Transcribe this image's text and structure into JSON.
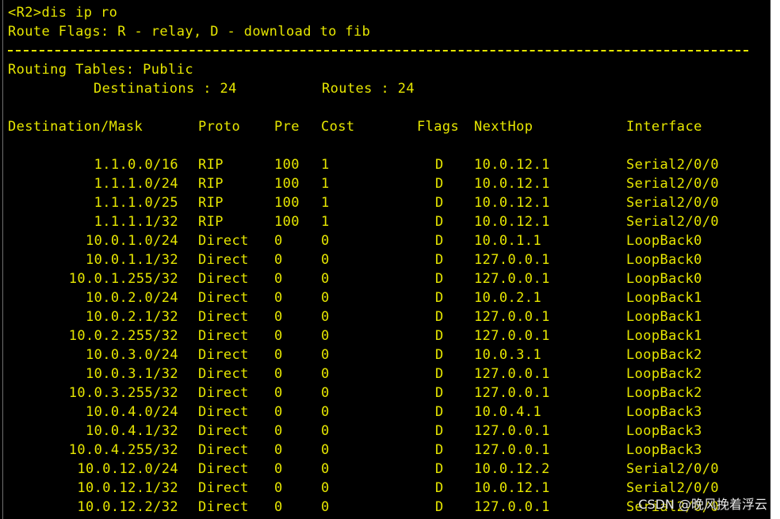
{
  "terminal": {
    "prompt_line": "<R2>dis ip ro",
    "flags_line": "Route Flags: R - relay, D - download to fib",
    "tables_label": "Routing Tables: Public",
    "destinations_label": "Destinations : 24",
    "routes_label": "Routes : 24",
    "headers": {
      "destination": "Destination/Mask",
      "proto": "Proto",
      "pre": "Pre",
      "cost": "Cost",
      "flags": "Flags",
      "nexthop": "NextHop",
      "interface": "Interface"
    },
    "routes": [
      {
        "dest": "1.1.0.0/16",
        "proto": "RIP",
        "pre": "100",
        "cost": "1",
        "flags": "D",
        "nexthop": "10.0.12.1",
        "iface": "Serial2/0/0"
      },
      {
        "dest": "1.1.1.0/24",
        "proto": "RIP",
        "pre": "100",
        "cost": "1",
        "flags": "D",
        "nexthop": "10.0.12.1",
        "iface": "Serial2/0/0"
      },
      {
        "dest": "1.1.1.0/25",
        "proto": "RIP",
        "pre": "100",
        "cost": "1",
        "flags": "D",
        "nexthop": "10.0.12.1",
        "iface": "Serial2/0/0"
      },
      {
        "dest": "1.1.1.1/32",
        "proto": "RIP",
        "pre": "100",
        "cost": "1",
        "flags": "D",
        "nexthop": "10.0.12.1",
        "iface": "Serial2/0/0"
      },
      {
        "dest": "10.0.1.0/24",
        "proto": "Direct",
        "pre": "0",
        "cost": "0",
        "flags": "D",
        "nexthop": "10.0.1.1",
        "iface": "LoopBack0"
      },
      {
        "dest": "10.0.1.1/32",
        "proto": "Direct",
        "pre": "0",
        "cost": "0",
        "flags": "D",
        "nexthop": "127.0.0.1",
        "iface": "LoopBack0"
      },
      {
        "dest": "10.0.1.255/32",
        "proto": "Direct",
        "pre": "0",
        "cost": "0",
        "flags": "D",
        "nexthop": "127.0.0.1",
        "iface": "LoopBack0"
      },
      {
        "dest": "10.0.2.0/24",
        "proto": "Direct",
        "pre": "0",
        "cost": "0",
        "flags": "D",
        "nexthop": "10.0.2.1",
        "iface": "LoopBack1"
      },
      {
        "dest": "10.0.2.1/32",
        "proto": "Direct",
        "pre": "0",
        "cost": "0",
        "flags": "D",
        "nexthop": "127.0.0.1",
        "iface": "LoopBack1"
      },
      {
        "dest": "10.0.2.255/32",
        "proto": "Direct",
        "pre": "0",
        "cost": "0",
        "flags": "D",
        "nexthop": "127.0.0.1",
        "iface": "LoopBack1"
      },
      {
        "dest": "10.0.3.0/24",
        "proto": "Direct",
        "pre": "0",
        "cost": "0",
        "flags": "D",
        "nexthop": "10.0.3.1",
        "iface": "LoopBack2"
      },
      {
        "dest": "10.0.3.1/32",
        "proto": "Direct",
        "pre": "0",
        "cost": "0",
        "flags": "D",
        "nexthop": "127.0.0.1",
        "iface": "LoopBack2"
      },
      {
        "dest": "10.0.3.255/32",
        "proto": "Direct",
        "pre": "0",
        "cost": "0",
        "flags": "D",
        "nexthop": "127.0.0.1",
        "iface": "LoopBack2"
      },
      {
        "dest": "10.0.4.0/24",
        "proto": "Direct",
        "pre": "0",
        "cost": "0",
        "flags": "D",
        "nexthop": "10.0.4.1",
        "iface": "LoopBack3"
      },
      {
        "dest": "10.0.4.1/32",
        "proto": "Direct",
        "pre": "0",
        "cost": "0",
        "flags": "D",
        "nexthop": "127.0.0.1",
        "iface": "LoopBack3"
      },
      {
        "dest": "10.0.4.255/32",
        "proto": "Direct",
        "pre": "0",
        "cost": "0",
        "flags": "D",
        "nexthop": "127.0.0.1",
        "iface": "LoopBack3"
      },
      {
        "dest": "10.0.12.0/24",
        "proto": "Direct",
        "pre": "0",
        "cost": "0",
        "flags": "D",
        "nexthop": "10.0.12.2",
        "iface": "Serial2/0/0"
      },
      {
        "dest": "10.0.12.1/32",
        "proto": "Direct",
        "pre": "0",
        "cost": "0",
        "flags": "D",
        "nexthop": "10.0.12.1",
        "iface": "Serial2/0/0"
      },
      {
        "dest": "10.0.12.2/32",
        "proto": "Direct",
        "pre": "0",
        "cost": "0",
        "flags": "D",
        "nexthop": "127.0.0.1",
        "iface": "Serial2/0/0"
      }
    ]
  },
  "watermark": "CSDN @晚风挽着浮云",
  "colors": {
    "background": "#000000",
    "text": "#e6e600",
    "gutter": "#ffffff"
  }
}
